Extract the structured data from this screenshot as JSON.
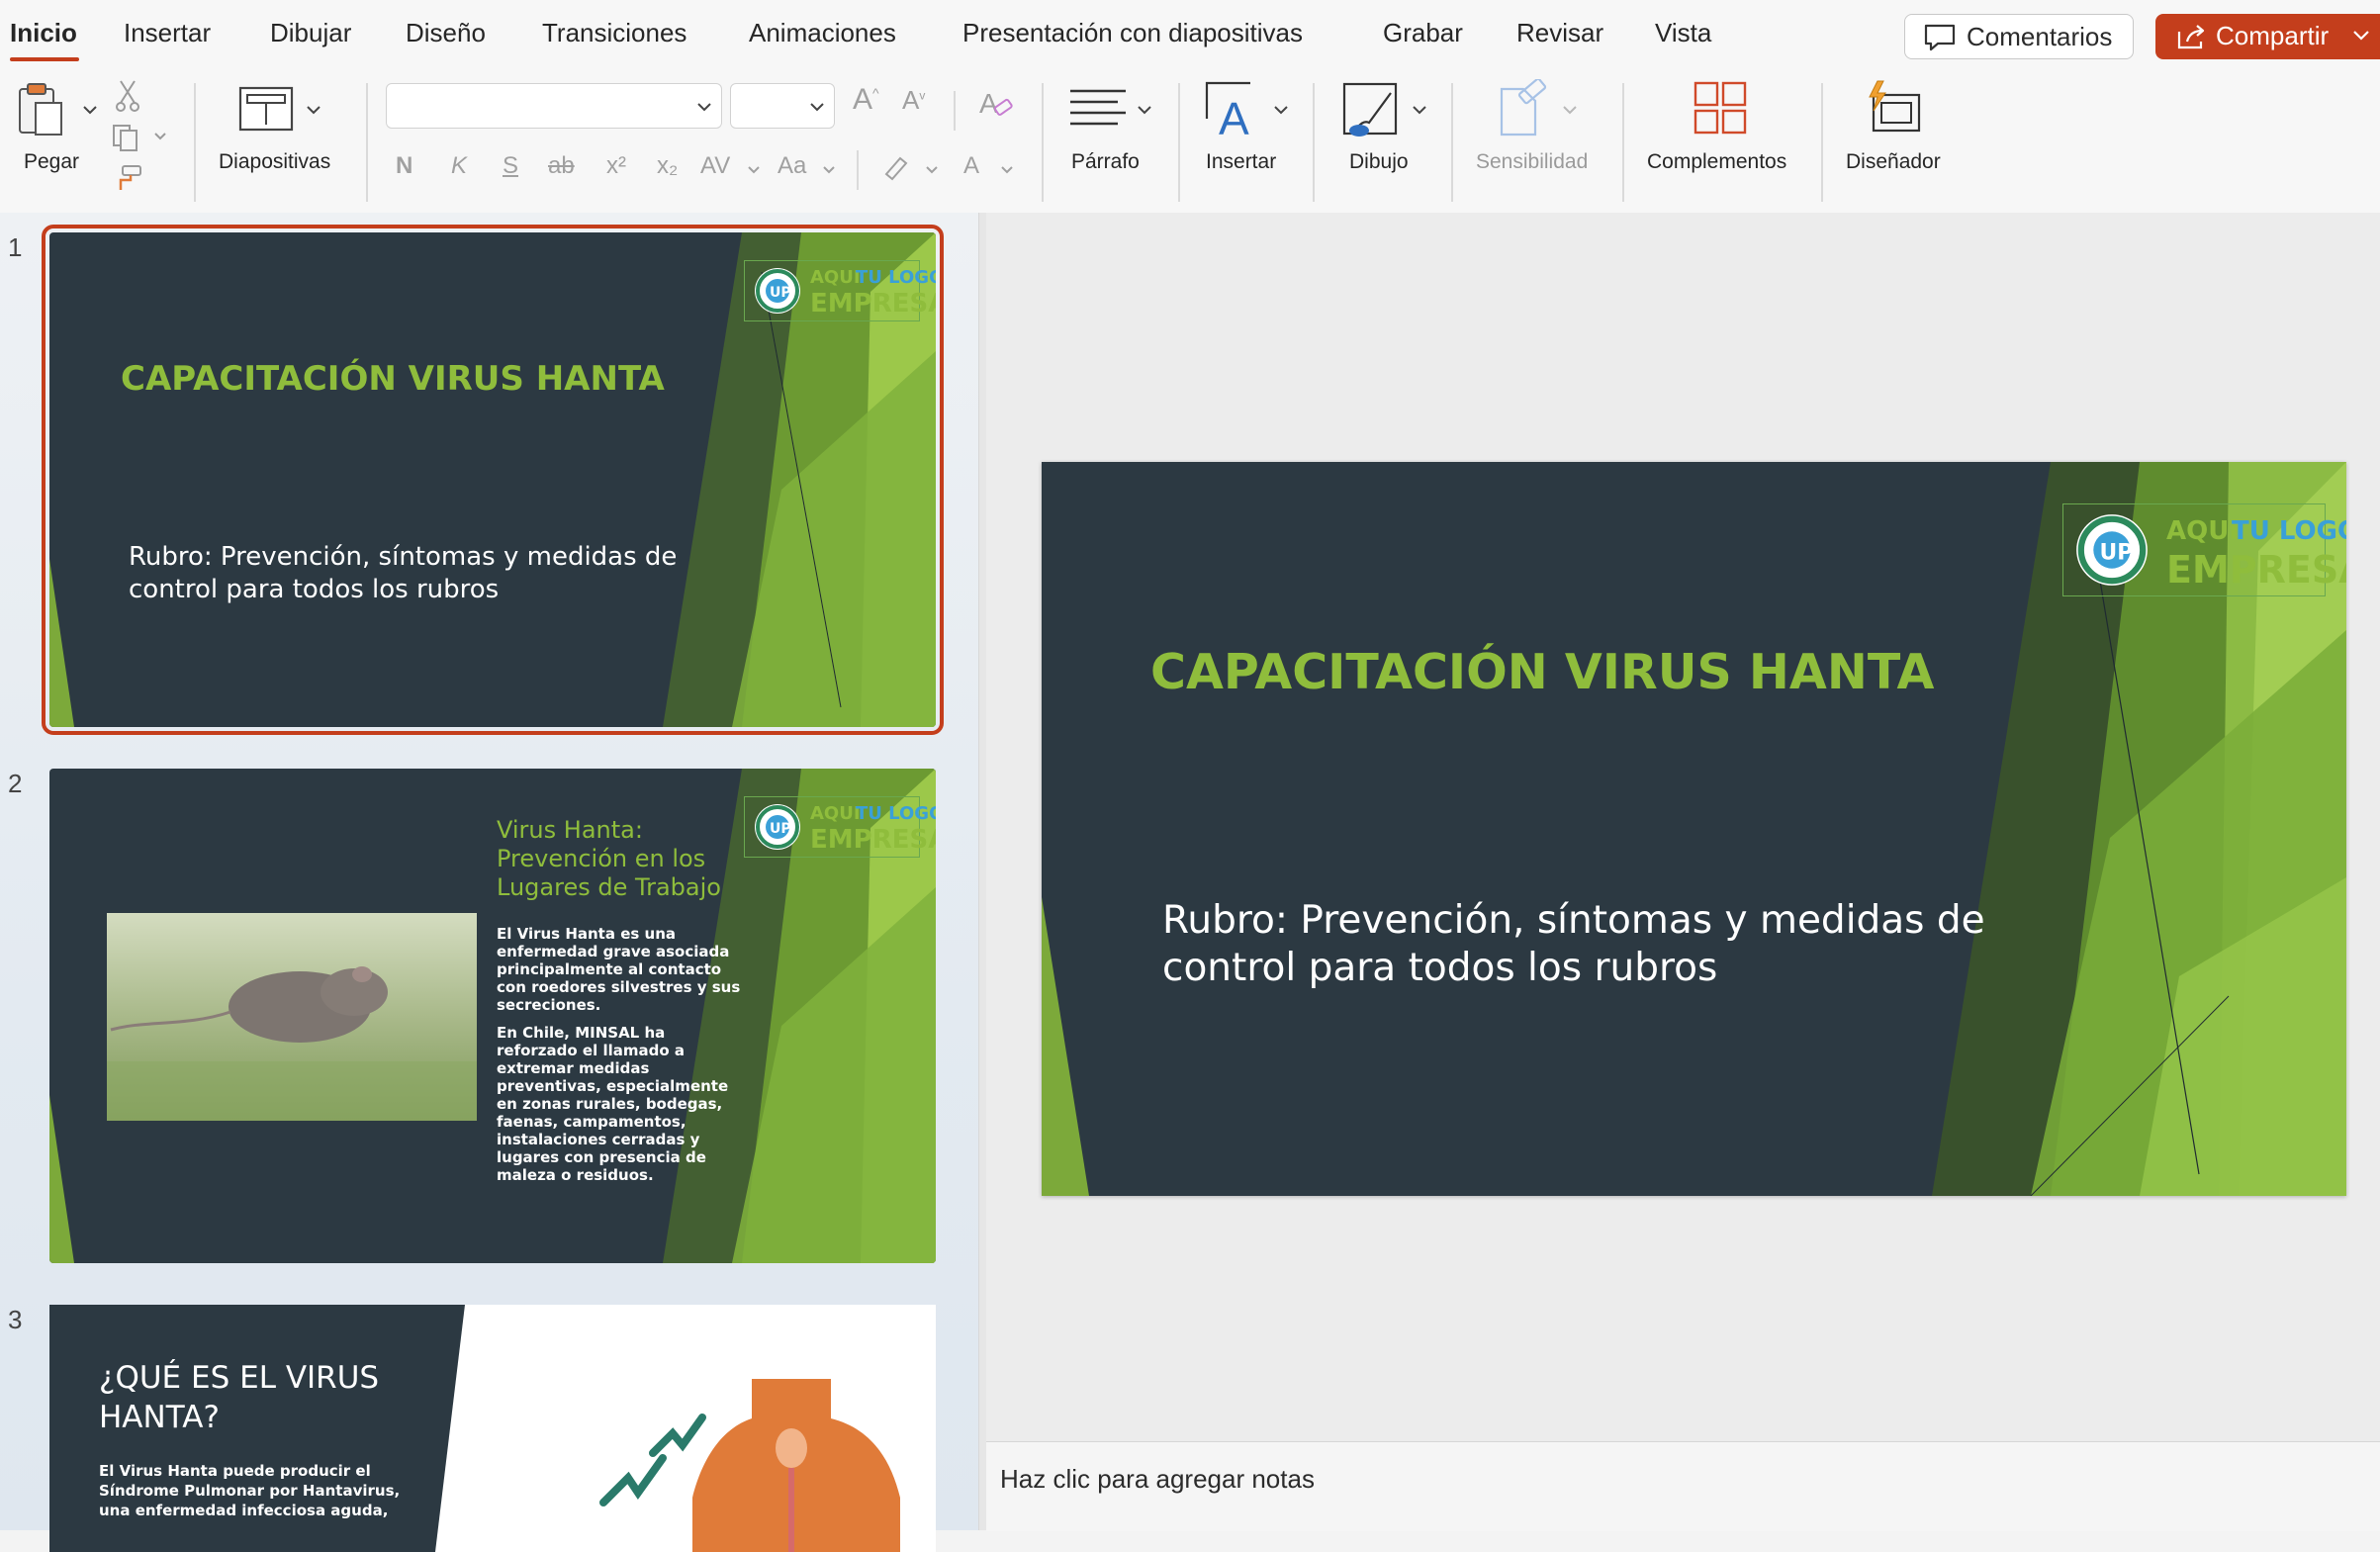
{
  "tabs": [
    {
      "label": "Inicio",
      "active": true
    },
    {
      "label": "Insertar"
    },
    {
      "label": "Dibujar"
    },
    {
      "label": "Diseño"
    },
    {
      "label": "Transiciones"
    },
    {
      "label": "Animaciones"
    },
    {
      "label": "Presentación con diapositivas"
    },
    {
      "label": "Grabar"
    },
    {
      "label": "Revisar"
    },
    {
      "label": "Vista"
    }
  ],
  "header": {
    "comments_label": "Comentarios",
    "share_label": "Compartir"
  },
  "ribbon": {
    "paste_label": "Pegar",
    "slides_label": "Diapositivas",
    "paragraph_label": "Párrafo",
    "insert_label": "Insertar",
    "draw_label": "Dibujo",
    "sensitivity_label": "Sensibilidad",
    "addins_label": "Complementos",
    "designer_label": "Diseñador",
    "font_name_value": "",
    "font_size_value": "",
    "format_buttons": [
      "N",
      "K",
      "S",
      "ab",
      "x²",
      "x₂",
      "AV",
      "Aa",
      "A"
    ]
  },
  "slides": [
    {
      "number": "1",
      "title": "CAPACITACIÓN VIRUS HANTA",
      "subtitle_line1": "Rubro: Prevención, síntomas y medidas de",
      "subtitle_line2": "control para todos los rubros",
      "selected": true
    },
    {
      "number": "2",
      "title_line1": "Virus Hanta:",
      "title_line2": "Prevención en los",
      "title_line3": "Lugares de Trabajo",
      "para1": [
        "El Virus Hanta es una",
        "enfermedad grave asociada",
        "principalmente al contacto",
        "con roedores silvestres y sus",
        "secreciones."
      ],
      "para2": [
        "En Chile, MINSAL ha",
        "reforzado el llamado a",
        "extremar medidas",
        "preventivas, especialmente",
        "en zonas rurales, bodegas,",
        "faenas, campamentos,",
        "instalaciones cerradas y",
        "lugares con presencia de",
        "maleza o residuos."
      ]
    },
    {
      "number": "3",
      "title_line1": "¿QUÉ ES EL VIRUS",
      "title_line2": "HANTA?",
      "body": [
        "El Virus Hanta puede producir el",
        "Síndrome Pulmonar por Hantavirus,",
        "una enfermedad infecciosa aguda,"
      ]
    }
  ],
  "logo": {
    "line1a": "AQUI",
    "line1b": "TU LOGO",
    "line2": "EMPRESA"
  },
  "notes_placeholder": "Haz clic para agregar notas",
  "colors": {
    "accent": "#c43e1c",
    "slide_bg": "#2c3942",
    "slide_green": "#8fbd3c"
  }
}
